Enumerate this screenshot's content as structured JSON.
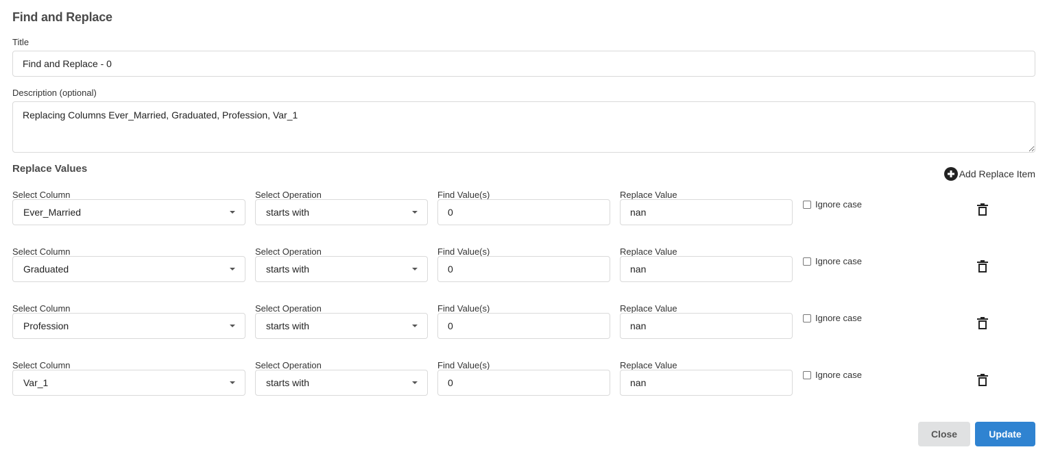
{
  "modal": {
    "title": "Find and Replace"
  },
  "form": {
    "title_label": "Title",
    "title_value": "Find and Replace - 0",
    "description_label": "Description (optional)",
    "description_value": "Replacing Columns Ever_Married, Graduated, Profession, Var_1"
  },
  "replace_values": {
    "section_title": "Replace Values",
    "add_item_label": "Add Replace Item",
    "labels": {
      "column": "Select Column",
      "operation": "Select Operation",
      "find": "Find Value(s)",
      "replace": "Replace Value",
      "ignore_case": "Ignore case"
    },
    "items": [
      {
        "column": "Ever_Married",
        "operation": "starts with",
        "find": "0",
        "replace": "nan",
        "ignore_case": false
      },
      {
        "column": "Graduated",
        "operation": "starts with",
        "find": "0",
        "replace": "nan",
        "ignore_case": false
      },
      {
        "column": "Profession",
        "operation": "starts with",
        "find": "0",
        "replace": "nan",
        "ignore_case": false
      },
      {
        "column": "Var_1",
        "operation": "starts with",
        "find": "0",
        "replace": "nan",
        "ignore_case": false
      }
    ]
  },
  "footer": {
    "close_label": "Close",
    "update_label": "Update"
  },
  "colors": {
    "primary": "#2f83d1",
    "secondary": "#e0e1e2"
  }
}
